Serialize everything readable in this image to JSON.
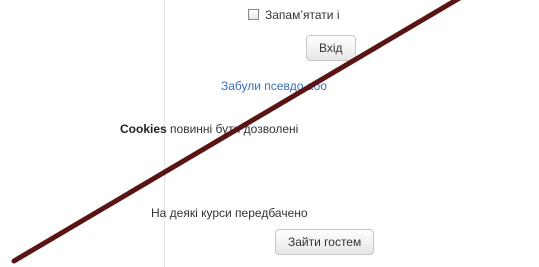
{
  "login": {
    "remember_label": "Запам’ятати і",
    "login_button": "Вхід",
    "forgot_link": "Забули псевдо або",
    "cookies_bold": "Cookies",
    "cookies_text": " повинні бути дозволені",
    "guest_info": "На деякі курси передбачено",
    "guest_button": "Зайти гостем"
  },
  "colors": {
    "link": "#3a6fb5",
    "slash_line": "#5a1414"
  }
}
